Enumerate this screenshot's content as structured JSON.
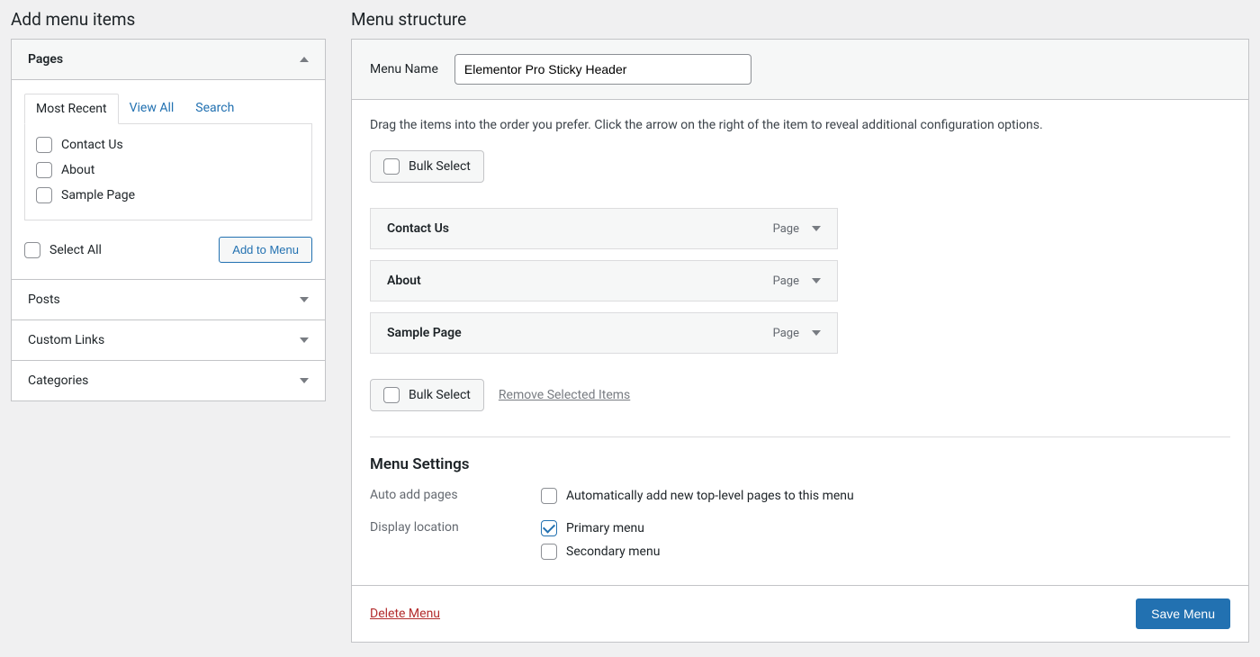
{
  "left": {
    "title": "Add menu items",
    "sections": [
      {
        "label": "Pages",
        "open": true
      },
      {
        "label": "Posts",
        "open": false
      },
      {
        "label": "Custom Links",
        "open": false
      },
      {
        "label": "Categories",
        "open": false
      }
    ],
    "tabs": [
      {
        "label": "Most Recent",
        "active": true
      },
      {
        "label": "View All",
        "active": false
      },
      {
        "label": "Search",
        "active": false
      }
    ],
    "pages": [
      {
        "label": "Contact Us"
      },
      {
        "label": "About"
      },
      {
        "label": "Sample Page"
      }
    ],
    "select_all_label": "Select All",
    "add_to_menu_label": "Add to Menu"
  },
  "right": {
    "title": "Menu structure",
    "menu_name_label": "Menu Name",
    "menu_name_value": "Elementor Pro Sticky Header",
    "help_text": "Drag the items into the order you prefer. Click the arrow on the right of the item to reveal additional configuration options.",
    "bulk_select_label": "Bulk Select",
    "remove_selected_label": "Remove Selected Items",
    "menu_items": [
      {
        "title": "Contact Us",
        "type": "Page"
      },
      {
        "title": "About",
        "type": "Page"
      },
      {
        "title": "Sample Page",
        "type": "Page"
      }
    ],
    "settings": {
      "heading": "Menu Settings",
      "auto_add_label": "Auto add pages",
      "auto_add_option": "Automatically add new top-level pages to this menu",
      "display_location_label": "Display location",
      "locations": [
        {
          "label": "Primary menu",
          "checked": true
        },
        {
          "label": "Secondary menu",
          "checked": false
        }
      ]
    },
    "delete_menu_label": "Delete Menu",
    "save_menu_label": "Save Menu"
  }
}
